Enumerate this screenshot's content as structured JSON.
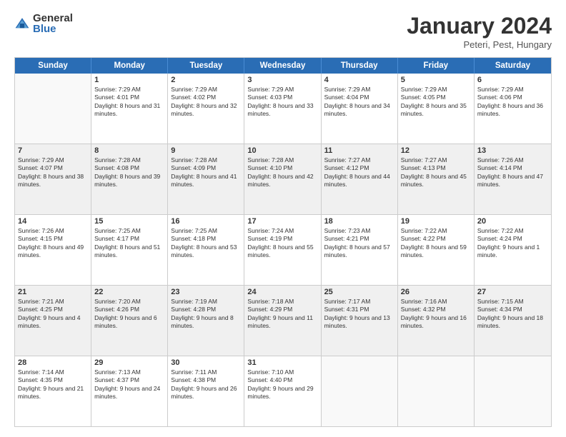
{
  "logo": {
    "general": "General",
    "blue": "Blue"
  },
  "title": {
    "month": "January 2024",
    "location": "Peteri, Pest, Hungary"
  },
  "header_days": [
    "Sunday",
    "Monday",
    "Tuesday",
    "Wednesday",
    "Thursday",
    "Friday",
    "Saturday"
  ],
  "weeks": [
    {
      "shaded": false,
      "days": [
        {
          "num": "",
          "sunrise": "",
          "sunset": "",
          "daylight": "",
          "empty": true
        },
        {
          "num": "1",
          "sunrise": "Sunrise: 7:29 AM",
          "sunset": "Sunset: 4:01 PM",
          "daylight": "Daylight: 8 hours and 31 minutes.",
          "empty": false
        },
        {
          "num": "2",
          "sunrise": "Sunrise: 7:29 AM",
          "sunset": "Sunset: 4:02 PM",
          "daylight": "Daylight: 8 hours and 32 minutes.",
          "empty": false
        },
        {
          "num": "3",
          "sunrise": "Sunrise: 7:29 AM",
          "sunset": "Sunset: 4:03 PM",
          "daylight": "Daylight: 8 hours and 33 minutes.",
          "empty": false
        },
        {
          "num": "4",
          "sunrise": "Sunrise: 7:29 AM",
          "sunset": "Sunset: 4:04 PM",
          "daylight": "Daylight: 8 hours and 34 minutes.",
          "empty": false
        },
        {
          "num": "5",
          "sunrise": "Sunrise: 7:29 AM",
          "sunset": "Sunset: 4:05 PM",
          "daylight": "Daylight: 8 hours and 35 minutes.",
          "empty": false
        },
        {
          "num": "6",
          "sunrise": "Sunrise: 7:29 AM",
          "sunset": "Sunset: 4:06 PM",
          "daylight": "Daylight: 8 hours and 36 minutes.",
          "empty": false
        }
      ]
    },
    {
      "shaded": true,
      "days": [
        {
          "num": "7",
          "sunrise": "Sunrise: 7:29 AM",
          "sunset": "Sunset: 4:07 PM",
          "daylight": "Daylight: 8 hours and 38 minutes.",
          "empty": false
        },
        {
          "num": "8",
          "sunrise": "Sunrise: 7:28 AM",
          "sunset": "Sunset: 4:08 PM",
          "daylight": "Daylight: 8 hours and 39 minutes.",
          "empty": false
        },
        {
          "num": "9",
          "sunrise": "Sunrise: 7:28 AM",
          "sunset": "Sunset: 4:09 PM",
          "daylight": "Daylight: 8 hours and 41 minutes.",
          "empty": false
        },
        {
          "num": "10",
          "sunrise": "Sunrise: 7:28 AM",
          "sunset": "Sunset: 4:10 PM",
          "daylight": "Daylight: 8 hours and 42 minutes.",
          "empty": false
        },
        {
          "num": "11",
          "sunrise": "Sunrise: 7:27 AM",
          "sunset": "Sunset: 4:12 PM",
          "daylight": "Daylight: 8 hours and 44 minutes.",
          "empty": false
        },
        {
          "num": "12",
          "sunrise": "Sunrise: 7:27 AM",
          "sunset": "Sunset: 4:13 PM",
          "daylight": "Daylight: 8 hours and 45 minutes.",
          "empty": false
        },
        {
          "num": "13",
          "sunrise": "Sunrise: 7:26 AM",
          "sunset": "Sunset: 4:14 PM",
          "daylight": "Daylight: 8 hours and 47 minutes.",
          "empty": false
        }
      ]
    },
    {
      "shaded": false,
      "days": [
        {
          "num": "14",
          "sunrise": "Sunrise: 7:26 AM",
          "sunset": "Sunset: 4:15 PM",
          "daylight": "Daylight: 8 hours and 49 minutes.",
          "empty": false
        },
        {
          "num": "15",
          "sunrise": "Sunrise: 7:25 AM",
          "sunset": "Sunset: 4:17 PM",
          "daylight": "Daylight: 8 hours and 51 minutes.",
          "empty": false
        },
        {
          "num": "16",
          "sunrise": "Sunrise: 7:25 AM",
          "sunset": "Sunset: 4:18 PM",
          "daylight": "Daylight: 8 hours and 53 minutes.",
          "empty": false
        },
        {
          "num": "17",
          "sunrise": "Sunrise: 7:24 AM",
          "sunset": "Sunset: 4:19 PM",
          "daylight": "Daylight: 8 hours and 55 minutes.",
          "empty": false
        },
        {
          "num": "18",
          "sunrise": "Sunrise: 7:23 AM",
          "sunset": "Sunset: 4:21 PM",
          "daylight": "Daylight: 8 hours and 57 minutes.",
          "empty": false
        },
        {
          "num": "19",
          "sunrise": "Sunrise: 7:22 AM",
          "sunset": "Sunset: 4:22 PM",
          "daylight": "Daylight: 8 hours and 59 minutes.",
          "empty": false
        },
        {
          "num": "20",
          "sunrise": "Sunrise: 7:22 AM",
          "sunset": "Sunset: 4:24 PM",
          "daylight": "Daylight: 9 hours and 1 minute.",
          "empty": false
        }
      ]
    },
    {
      "shaded": true,
      "days": [
        {
          "num": "21",
          "sunrise": "Sunrise: 7:21 AM",
          "sunset": "Sunset: 4:25 PM",
          "daylight": "Daylight: 9 hours and 4 minutes.",
          "empty": false
        },
        {
          "num": "22",
          "sunrise": "Sunrise: 7:20 AM",
          "sunset": "Sunset: 4:26 PM",
          "daylight": "Daylight: 9 hours and 6 minutes.",
          "empty": false
        },
        {
          "num": "23",
          "sunrise": "Sunrise: 7:19 AM",
          "sunset": "Sunset: 4:28 PM",
          "daylight": "Daylight: 9 hours and 8 minutes.",
          "empty": false
        },
        {
          "num": "24",
          "sunrise": "Sunrise: 7:18 AM",
          "sunset": "Sunset: 4:29 PM",
          "daylight": "Daylight: 9 hours and 11 minutes.",
          "empty": false
        },
        {
          "num": "25",
          "sunrise": "Sunrise: 7:17 AM",
          "sunset": "Sunset: 4:31 PM",
          "daylight": "Daylight: 9 hours and 13 minutes.",
          "empty": false
        },
        {
          "num": "26",
          "sunrise": "Sunrise: 7:16 AM",
          "sunset": "Sunset: 4:32 PM",
          "daylight": "Daylight: 9 hours and 16 minutes.",
          "empty": false
        },
        {
          "num": "27",
          "sunrise": "Sunrise: 7:15 AM",
          "sunset": "Sunset: 4:34 PM",
          "daylight": "Daylight: 9 hours and 18 minutes.",
          "empty": false
        }
      ]
    },
    {
      "shaded": false,
      "days": [
        {
          "num": "28",
          "sunrise": "Sunrise: 7:14 AM",
          "sunset": "Sunset: 4:35 PM",
          "daylight": "Daylight: 9 hours and 21 minutes.",
          "empty": false
        },
        {
          "num": "29",
          "sunrise": "Sunrise: 7:13 AM",
          "sunset": "Sunset: 4:37 PM",
          "daylight": "Daylight: 9 hours and 24 minutes.",
          "empty": false
        },
        {
          "num": "30",
          "sunrise": "Sunrise: 7:11 AM",
          "sunset": "Sunset: 4:38 PM",
          "daylight": "Daylight: 9 hours and 26 minutes.",
          "empty": false
        },
        {
          "num": "31",
          "sunrise": "Sunrise: 7:10 AM",
          "sunset": "Sunset: 4:40 PM",
          "daylight": "Daylight: 9 hours and 29 minutes.",
          "empty": false
        },
        {
          "num": "",
          "sunrise": "",
          "sunset": "",
          "daylight": "",
          "empty": true
        },
        {
          "num": "",
          "sunrise": "",
          "sunset": "",
          "daylight": "",
          "empty": true
        },
        {
          "num": "",
          "sunrise": "",
          "sunset": "",
          "daylight": "",
          "empty": true
        }
      ]
    }
  ]
}
